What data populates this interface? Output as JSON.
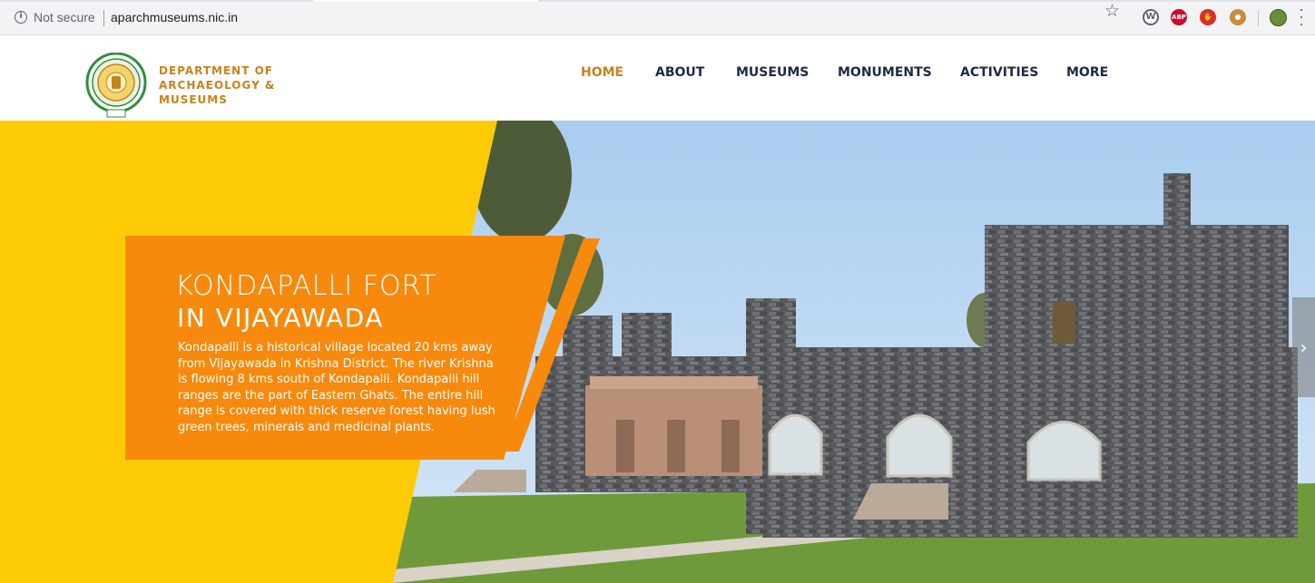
{
  "browser": {
    "security_label": "Not secure",
    "url": "aparchmuseums.nic.in",
    "extensions": [
      "wordpress-icon",
      "adblock-plus-icon",
      "stop-hand-icon",
      "cookie-icon"
    ],
    "abp_label": "ABP"
  },
  "header": {
    "dept_line1": "DEPARTMENT OF",
    "dept_line2": "ARCHAEOLOGY &",
    "dept_line3": "MUSEUMS",
    "nav": [
      {
        "label": "HOME",
        "active": true
      },
      {
        "label": "ABOUT",
        "active": false
      },
      {
        "label": "MUSEUMS",
        "active": false
      },
      {
        "label": "MONUMENTS",
        "active": false
      },
      {
        "label": "ACTIVITIES",
        "active": false
      },
      {
        "label": "MORE",
        "active": false
      }
    ]
  },
  "hero": {
    "title_line1": "KONDAPALLI FORT",
    "title_line2": "IN VIJAYAWADA",
    "description": "Kondapalli is a historical village located 20 kms away from Vijayawada in Krishna District. The river Krishna is flowing 8 kms south of Kondapalli.  Kondapalli hill ranges are the part of Eastern Ghats. The entire hill range is covered with thick reserve forest having lush green trees, minerals and medicinal plants.",
    "next_arrow": "›"
  },
  "colors": {
    "accent": "#c7821c",
    "nav_text": "#1f2a44",
    "hero_yellow": "#fdcb05",
    "hero_orange": "#f7890d"
  }
}
